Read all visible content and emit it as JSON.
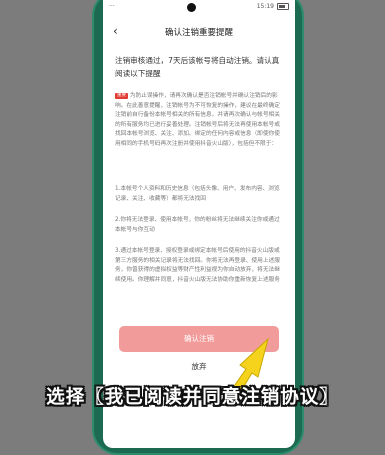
{
  "status_bar": {
    "left": "···",
    "time": "15:19"
  },
  "header": {
    "title": "确认注销重要提醒"
  },
  "intro": "注销审核通过，7天后该帐号将自动注销。请认真阅读以下提醒",
  "warning": {
    "badge": "重要",
    "text": "为防止误操作，请再次确认是否注销帐号并确认注销后的影响。在此善意提醒，注销帐号为不可恢复的操作，建议在最终确定注销前自行备份本帐号相关的所有信息，并请再次确认与帐号相关的所有服务均已进行妥善处理。注销帐号后将无法再使用本帐号或找回本帐号浏览、关注、添加、绑定的任何内容或信息（即使你使用相同的手机号码再次注册并使用抖音火山版），包括但不限于："
  },
  "points": [
    "1.本帐号个人资料和历史信息（包括头像、用户、发布内容、浏览记录、关注、收藏等）都将无法找回",
    "2.你将无法登录、使用本帐号，你的粉丝将无法继续关注你或通过本帐号与你互动",
    "3.通过本帐号登录、授权登录或绑定本帐号后使用的抖音火山版或第三方服务的相关记录将无法找回。你将无法再登录、使用上述服务，你曾获得的虚拟权益等财产性利益视为你自动放弃，将无法继续使用。你理解并同意，抖音火山版无法协助你重新恢复上述服务"
  ],
  "buttons": {
    "confirm": "确认注销",
    "give_up": "放弃"
  },
  "caption": "选择〖我已阅读并同意注销协议〗",
  "colors": {
    "confirm_bg": "#f19c9a",
    "arrow": "#f5d21c",
    "phone_frame": "#1d6a52"
  }
}
